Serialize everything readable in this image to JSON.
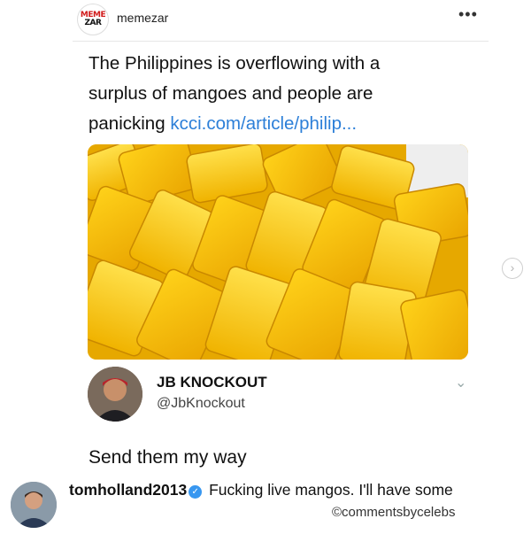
{
  "header": {
    "logo_line1": "MEME",
    "logo_line2": "ZAR",
    "username": "memezar",
    "more_icon": "more-dots-icon",
    "more_glyph": "•••"
  },
  "tweet": {
    "text": "The Philippines is overflowing with a surplus of mangoes and people are panicking ",
    "link": "kcci.com/article/philip...",
    "image_desc_color": "#f2b800"
  },
  "carousel": {
    "next_glyph": "›"
  },
  "reply_tweet": {
    "name": "JB KNOCKOUT",
    "handle": "@JbKnockout",
    "chevron": "⌄",
    "text": "Send them my way"
  },
  "comment": {
    "username": "tomholland2013",
    "verified_glyph": "✓",
    "text": " Fucking live mangos. I'll have some",
    "watermark": "©commentsbycelebs"
  },
  "colors": {
    "link": "#2c7fd8",
    "verified": "#3897f0",
    "logo_red": "#d11a1a",
    "mango": "#f2b800"
  }
}
